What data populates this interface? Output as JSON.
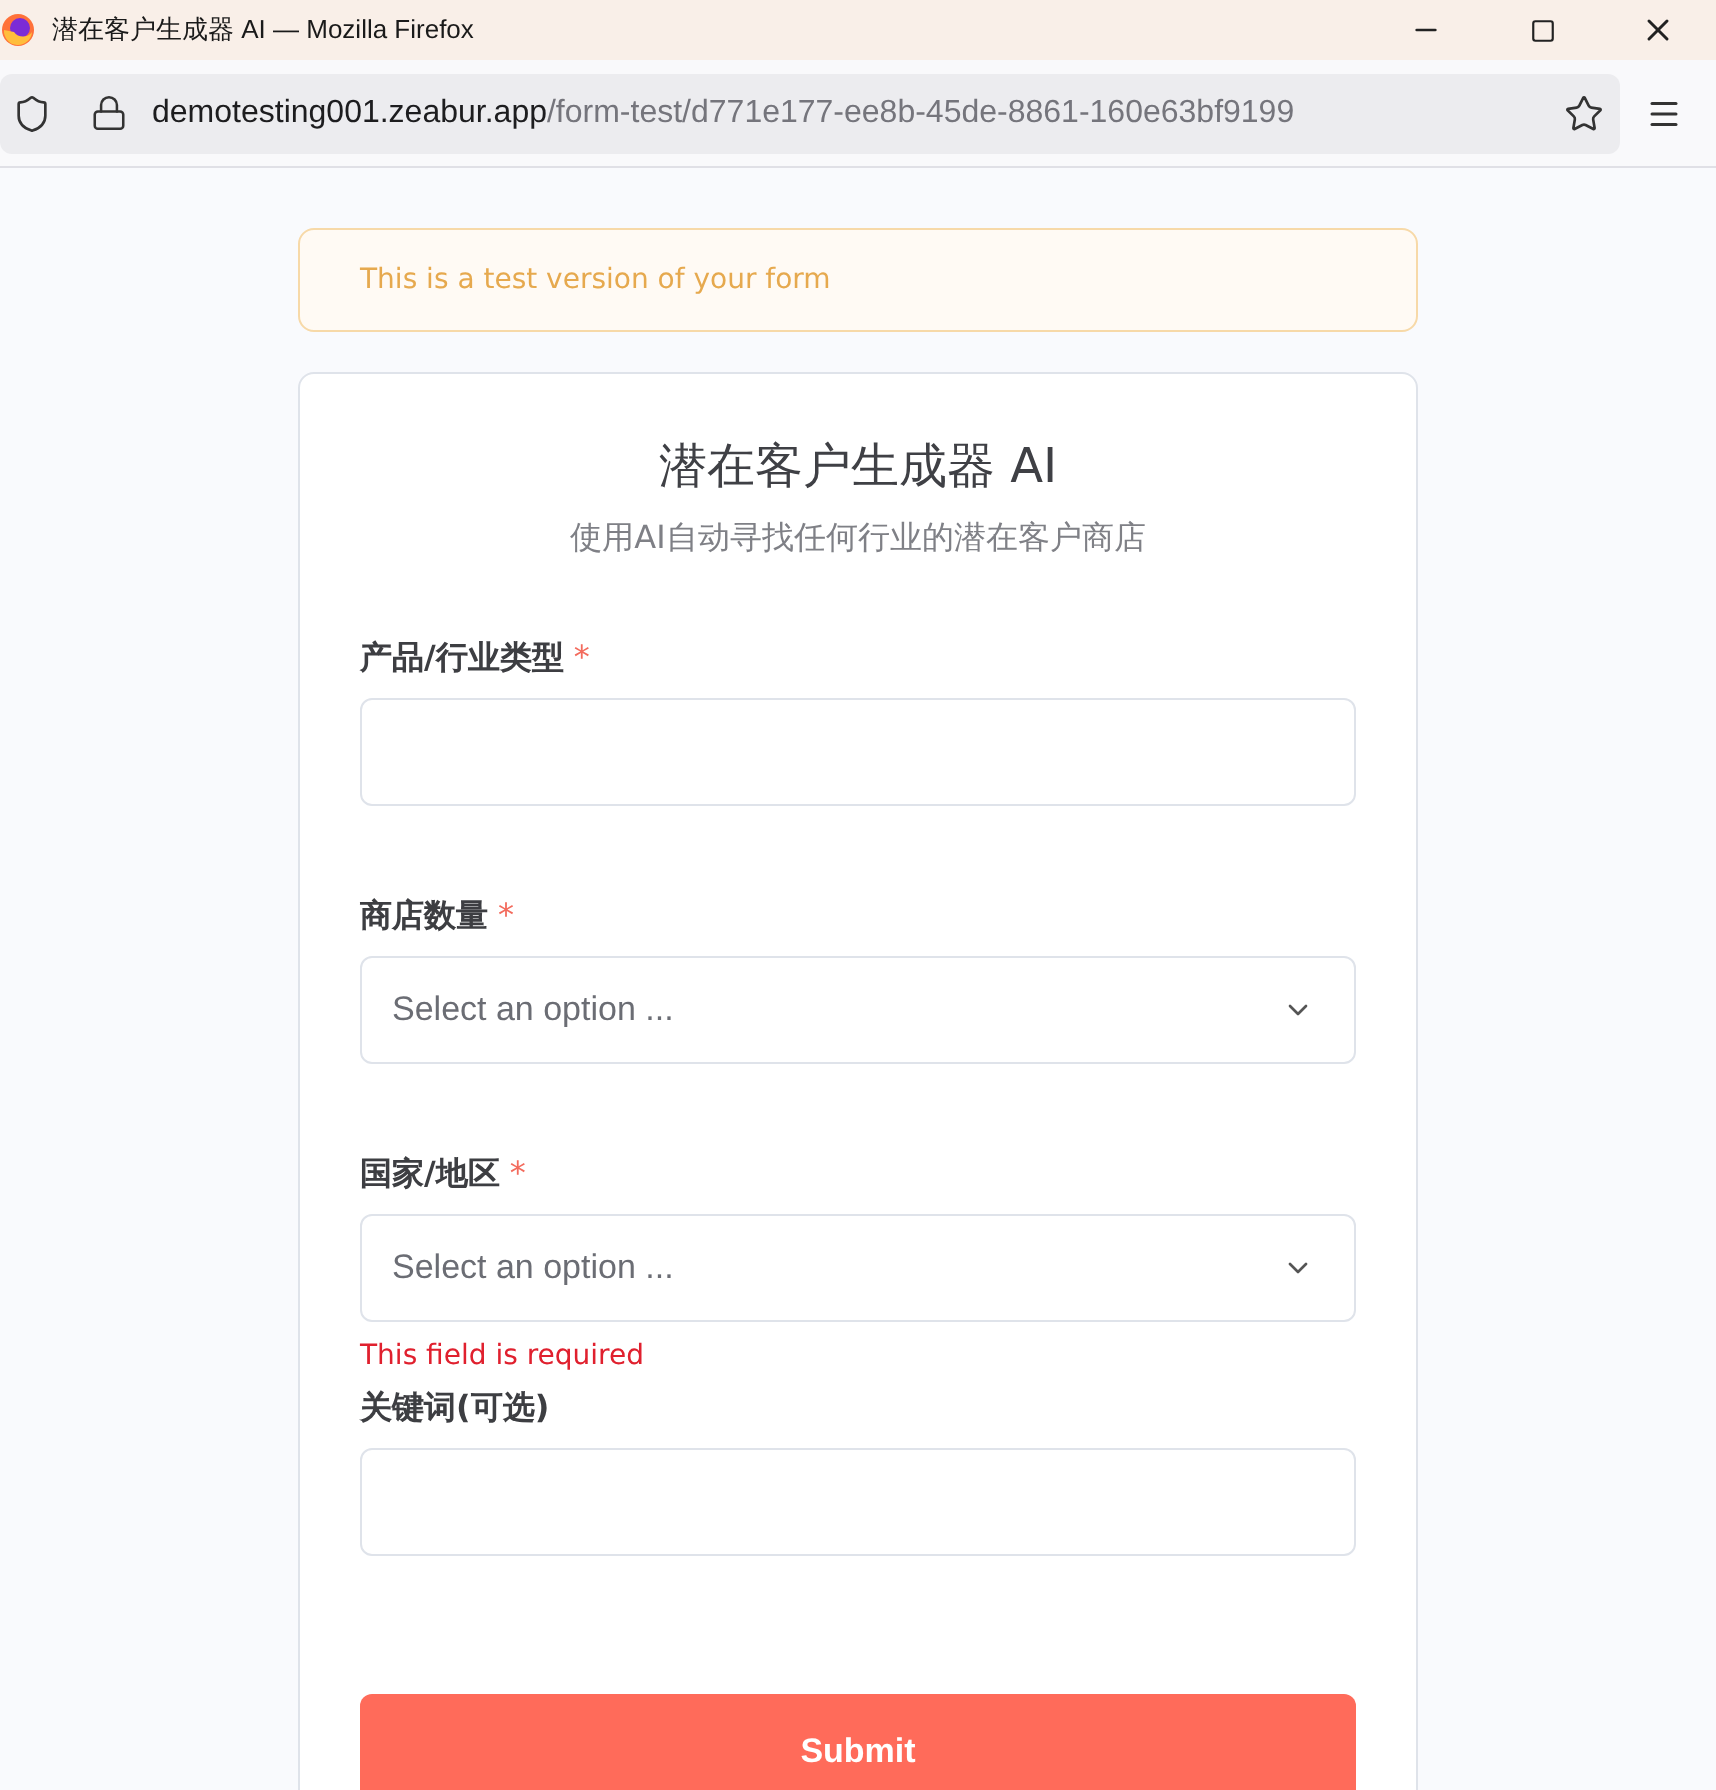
{
  "window": {
    "title": "潜在客户生成器 AI — Mozilla Firefox"
  },
  "address_bar": {
    "host": "demotesting001.zeabur.app",
    "path": "/form-test/d771e177-ee8b-45de-8861-160e63bf9199"
  },
  "notice": "This is a test version of your form",
  "form": {
    "title": "潜在客户生成器 AI",
    "subtitle": "使用AI自动寻找任何行业的潜在客户商店",
    "fields": [
      {
        "kind": "text",
        "label": "产品/行业类型",
        "required_mark": "*"
      },
      {
        "kind": "select",
        "label": "商店数量",
        "required_mark": "*",
        "placeholder": "Select an option ..."
      },
      {
        "kind": "select",
        "label": "国家/地区",
        "required_mark": "*",
        "placeholder": "Select an option ...",
        "error": "This field is required"
      },
      {
        "kind": "text",
        "label": "关键词(可选)"
      }
    ],
    "submit": "Submit"
  }
}
